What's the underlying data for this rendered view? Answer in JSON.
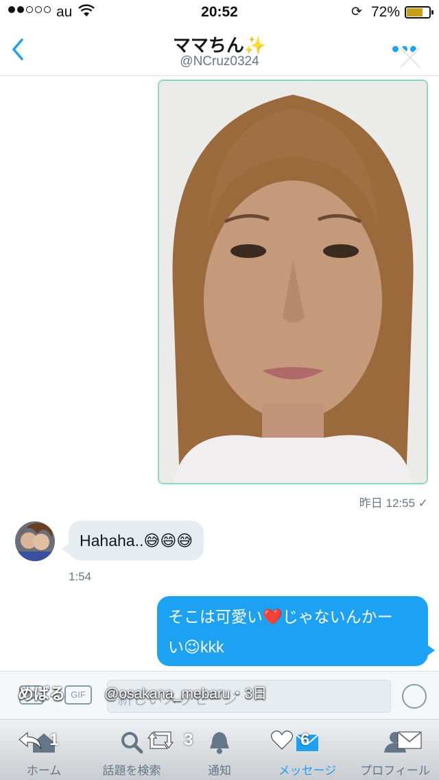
{
  "status_bar": {
    "carrier": "au",
    "time": "20:52",
    "battery_percent": "72%",
    "battery_level": 0.72
  },
  "header": {
    "name": "ママちん✨",
    "handle": "@NCruz0324"
  },
  "messages": {
    "photo_timestamp": "昨日 12:55 ✓",
    "incoming_text": "Hahaha..😅😄😅",
    "incoming_time": "1:54",
    "outgoing_line1": "そこは可愛い❤️じゃないんかー",
    "outgoing_line2": "い😉kkk"
  },
  "compose": {
    "gif_label": "GIF",
    "placeholder": "新しいメッセージ"
  },
  "overlay": {
    "username": "めばる",
    "handle_time": "@osakana_mebaru・3日"
  },
  "actions": {
    "reply_count": "1",
    "retweet_count": "3",
    "like_count": "6"
  },
  "tabs": [
    {
      "label": "ホーム",
      "icon": "home-icon"
    },
    {
      "label": "話題を検索",
      "icon": "search-icon"
    },
    {
      "label": "通知",
      "icon": "bell-icon"
    },
    {
      "label": "メッセージ",
      "icon": "envelope-icon"
    },
    {
      "label": "プロフィール",
      "icon": "person-icon"
    }
  ],
  "colors": {
    "accent": "#1da1f2",
    "photo_border": "#8ad8c0",
    "incoming_bubble": "#e6ecf0"
  }
}
